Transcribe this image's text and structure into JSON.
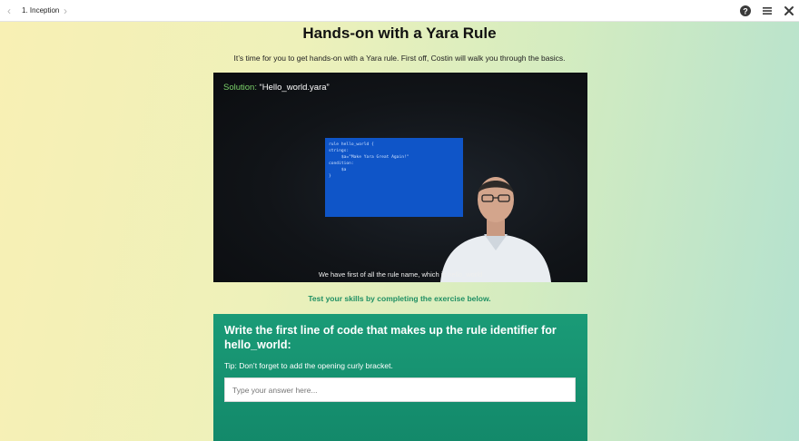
{
  "topbar": {
    "breadcrumb": "1. Inception",
    "icons": [
      "chevron-left-icon",
      "chevron-right-icon",
      "help-icon",
      "menu-icon",
      "close-icon"
    ]
  },
  "page": {
    "title": "Hands-on with a Yara Rule",
    "intro": "It’s time for you to get hands-on with a Yara rule. First off, Costin will walk you through the basics."
  },
  "video": {
    "solution_label": "Solution:",
    "solution_value": " “Hello_world.yara”",
    "code_lines": [
      "rule hello_world {",
      "",
      "strings:",
      "",
      "     $a=\"Make Yara Great Again!\"",
      "",
      "condition:",
      "     $a",
      "}"
    ],
    "subtitle": "We have first of all the rule name, which is hello_world"
  },
  "cta": "Test your skills by completing the exercise below.",
  "exercise": {
    "question": "Write the first line of code that makes up the rule identifier for hello_world:",
    "tip": "Tip: Don’t forget to add the opening curly bracket.",
    "answer_placeholder": "Type your answer here...",
    "answer_value": ""
  },
  "colors": {
    "accent_green": "#1a9b77",
    "code_slide_blue": "#0f55c8",
    "solution_label_green": "#7bd36a"
  }
}
